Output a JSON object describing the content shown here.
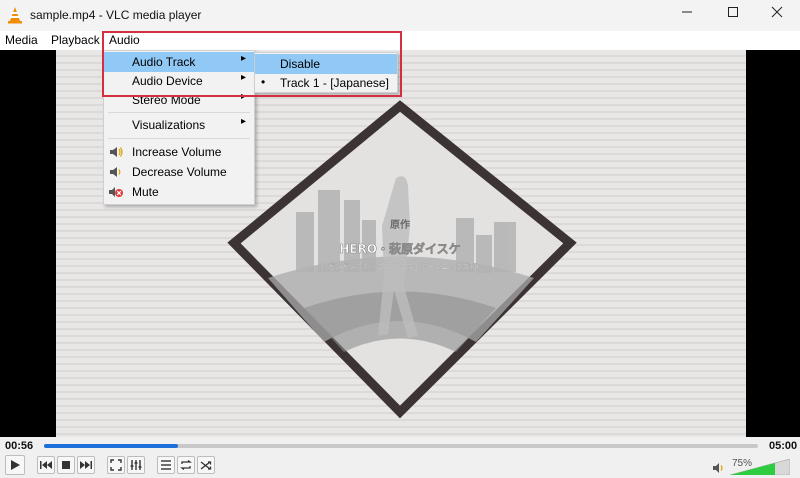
{
  "window": {
    "title": "sample.mp4 - VLC media player"
  },
  "menubar": {
    "items": [
      "Media",
      "Playback",
      "Audio"
    ]
  },
  "audio_menu": {
    "items": [
      {
        "label": "Audio Track",
        "arrow": "▸"
      },
      {
        "label": "Audio Device",
        "arrow": "▸"
      },
      {
        "label": "Stereo Mode",
        "arrow": "▸"
      },
      {
        "label": "Visualizations",
        "arrow": "▸"
      },
      {
        "label": "Increase Volume"
      },
      {
        "label": "Decrease Volume"
      },
      {
        "label": "Mute"
      }
    ]
  },
  "track_submenu": {
    "items": [
      {
        "label": "Disable",
        "bullet": ""
      },
      {
        "label": "Track 1 - [Japanese]",
        "bullet": "•"
      }
    ]
  },
  "video": {
    "title_small": "原作",
    "title_main": "HERO・萩原ダイスケ",
    "subtitle": "(「ガンガンコミックス スクウェア・エニックス刊)"
  },
  "player": {
    "elapsed": "00:56",
    "total": "05:00",
    "progress": 0.187,
    "volume_label": "75%",
    "volume": 0.75
  },
  "colors": {
    "accent": "#1e6fd9",
    "highlight": "#90c8f6",
    "annotation": "#d32f3f",
    "volume_green": "#2ecc40"
  }
}
